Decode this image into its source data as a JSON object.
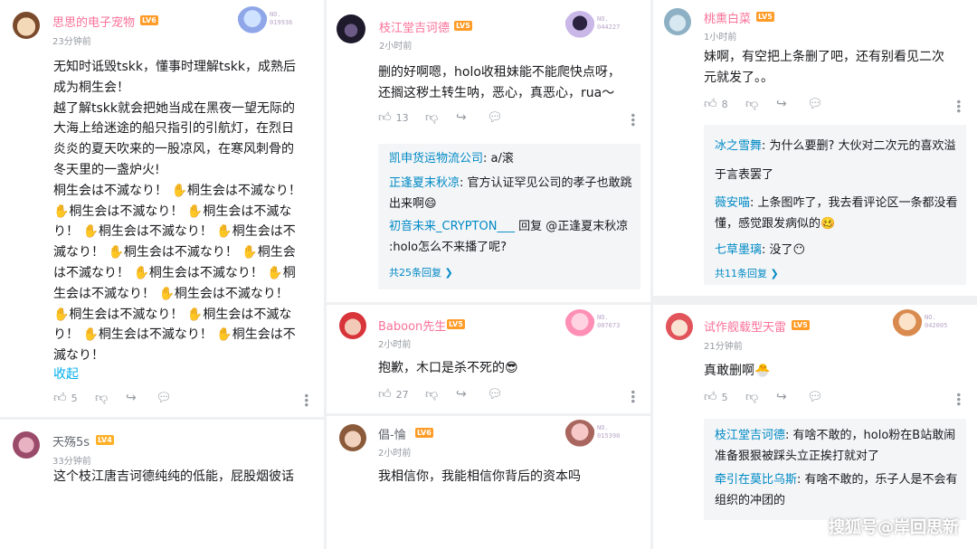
{
  "c1": {
    "user": "思思的电子宠物",
    "level": "LV6",
    "time": "23分钟前",
    "fan_no": "NO.\n019936",
    "lines": [
      "无知时诋毁tskk，懂事时理解tskk，成熟后",
      "成为桐生会！",
      "越了解tskk就会把她当成在黑夜一望无际的",
      "大海上给迷途的船只指引的引航灯，在烈日",
      "炎炎的夏天吹来的一股凉风，在寒风刺骨的",
      "冬天里的一盏炉火!",
      "桐生会は不滅なり！ ✋桐生会は不滅なり！",
      "✋桐生会は不滅なり！ ✋桐生会は不滅な",
      "り！ ✋桐生会は不滅なり！ ✋桐生会は不",
      "滅なり！ ✋桐生会は不滅なり！ ✋桐生会",
      "は不滅なり！ ✋桐生会は不滅なり！ ✋桐",
      "生会は不滅なり！ ✋桐生会は不滅なり！",
      "✋桐生会は不滅なり！ ✋桐生会は不滅な",
      "り！ ✋桐生会は不滅なり！ ✋桐生会は不",
      "滅なり！"
    ],
    "collapse": "收起",
    "likes": "5"
  },
  "c2": {
    "user": "天殇5s",
    "level": "LV4",
    "time": "33分钟前",
    "line": "这个枝江唐吉诃德纯纯的低能，屁股烟彼话"
  },
  "c3": {
    "user": "枝江堂吉诃德",
    "level": "LV5",
    "time": "2小时前",
    "fan_no": "NO.\n044227",
    "lines": [
      "删的好啊嗯，holo收租妹能不能爬快点呀，",
      "还搁这秽土转生呐，恶心，真恶心，rua～"
    ],
    "likes": "13",
    "replies": [
      {
        "name": "凯申货运物流公司",
        "text": ": a/滚"
      },
      {
        "name": "正逢夏末秋凉",
        "text": ": 官方认证罕见公司的孝子也敢跳出来啊😄"
      },
      {
        "name": "初音未来_CRYPTON___",
        "text": " 回复 @正逢夏末秋凉 :holo怎么不来播了呢?"
      }
    ],
    "total": "共25条回复 ❯"
  },
  "c4": {
    "user": "Baboon先生",
    "level": "LV5",
    "time": "2小时前",
    "fan_no": "NO.\n007673",
    "line": "抱歉，木口是杀不死的😎",
    "likes": "27"
  },
  "c5": {
    "user": "倡-惀",
    "level": "LV6",
    "time": "2小时前",
    "fan_no": "NO.\n015390",
    "line": "我相信你，我能相信你背后的资本吗"
  },
  "c6": {
    "user": "桃熏白菜",
    "level": "LV5",
    "time": "1小时前",
    "lines": [
      "妹啊，有空把上条删了吧，还有别看见二次",
      "元就发了。。"
    ],
    "likes": "8",
    "replies": [
      {
        "name": "冰之雪舞",
        "text": ": 为什么要删? 大伙对二次元的喜欢溢于言表罢了"
      },
      {
        "name": "薇安喵",
        "text": ": 上条图咋了，我去看评论区一条都没看懂，感觉跟发病似的🥴"
      },
      {
        "name": "七草墨璃",
        "text": ": 没了😶"
      }
    ],
    "total": "共11条回复 ❯"
  },
  "c7": {
    "user": "试作舰载型天雷",
    "level": "LV5",
    "time": "21分钟前",
    "fan_no": "NO.\n042005",
    "line": "真敢删啊🐣",
    "likes": "5",
    "replies": [
      {
        "name": "枝江堂吉诃德",
        "text": ": 有啥不敢的，holo粉在B站敢闹准备狠狠被踩头立正挨打就对了"
      },
      {
        "name": "牵引在莫比乌斯",
        "text": ": 有啥不敢的，乐子人是不会有组织的冲团的"
      }
    ]
  },
  "watermark": "搜狐号@岸回思新"
}
